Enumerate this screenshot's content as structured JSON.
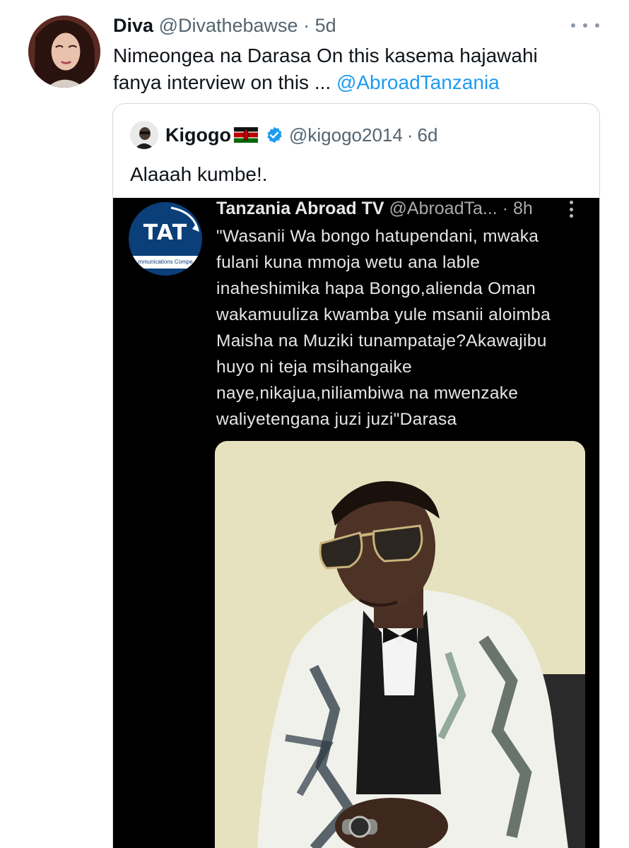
{
  "tweet": {
    "display_name": "Diva",
    "handle": "@Divathebawse",
    "separator": "·",
    "time": "5d",
    "text_line1": "Nimeongea na Darasa On this kasema hajawahi",
    "text_line2": "fanya interview on this ...",
    "mention": "@AbroadTanzania",
    "mention_color": "#1d9bf0"
  },
  "quoted_tweet": {
    "display_name": "Kigogo",
    "flag": "kenya-flag",
    "verified_icon": "verified-badge-icon",
    "handle": "@kigogo2014",
    "separator": "·",
    "time": "6d",
    "text": "Alaaah kumbe!."
  },
  "screenshot_media": {
    "logo_letters": "TAT",
    "logo_subtext": "mmunications Compe",
    "account_name": "Tanzania Abroad TV",
    "account_handle": "@AbroadTa...",
    "separator": "·",
    "time": "8h",
    "lines": [
      "\"Wasanii Wa bongo hatupendani, mwaka",
      "fulani kuna mmoja wetu ana lable",
      "inaheshimika hapa Bongo,aliendа Oman",
      "wakamuuliza kwamba yule msanii aloimba",
      "Maisha na Muziki tunampataje?Akawajibu",
      "huyo ni teja msihangaike",
      "naye,nikajua,niliambiwa na mwenzake",
      "waliyetengana juzi juzi\"Darasa"
    ]
  },
  "colors": {
    "accent": "#1d9bf0",
    "secondary_text": "#536471",
    "border": "#cfd9de"
  }
}
